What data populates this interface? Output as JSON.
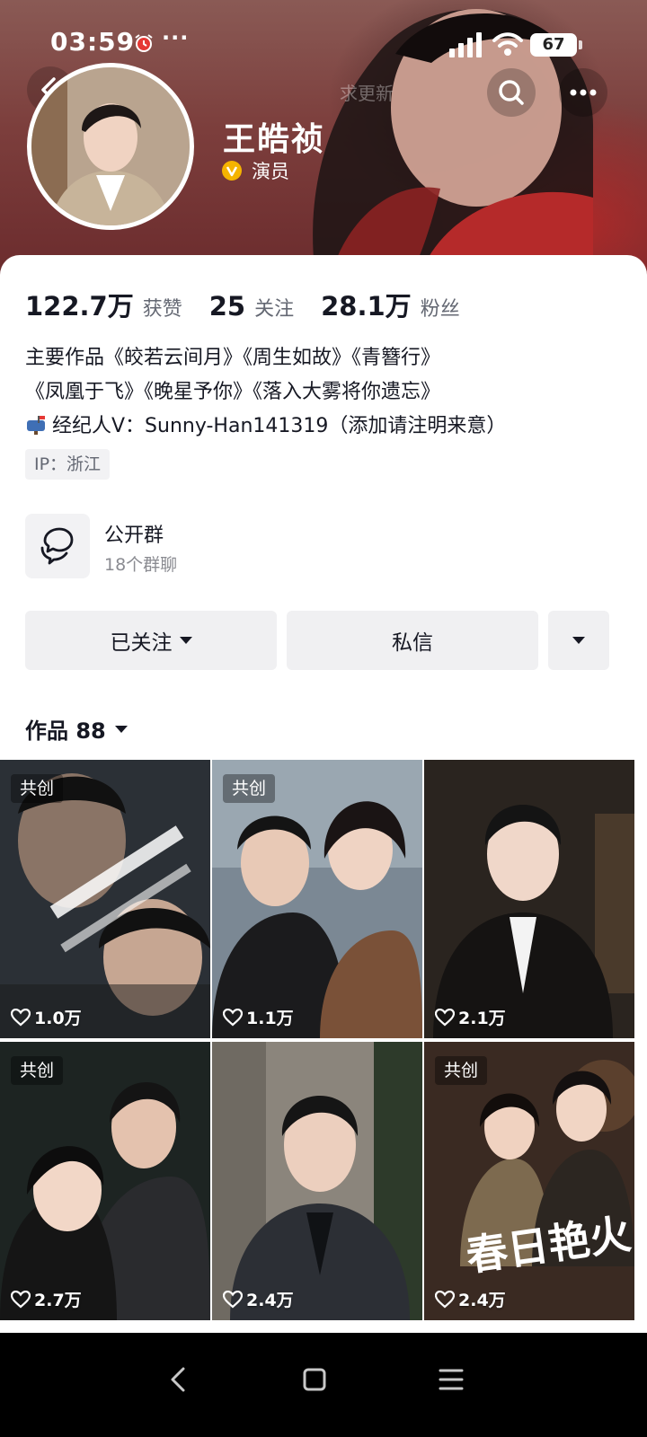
{
  "status_bar": {
    "time": "03:59",
    "dots": "···",
    "battery": "67"
  },
  "header": {
    "refresh_hint": "求更新"
  },
  "profile": {
    "name": "王皓祯",
    "role": "演员",
    "stats": [
      {
        "value": "122.7万",
        "label": "获赞"
      },
      {
        "value": "25",
        "label": "关注"
      },
      {
        "value": "28.1万",
        "label": "粉丝"
      }
    ],
    "bio": [
      "主要作品《皎若云间月》《周生如故》《青簪行》",
      "《凤凰于飞》《晚星予你》《落入大雾将你遗忘》",
      "经纪人V：Sunny-Han141319（添加请注明来意）"
    ],
    "ip": "IP：浙江"
  },
  "group": {
    "title": "公开群",
    "subtitle": "18个群聊"
  },
  "actions": {
    "follow": "已关注",
    "message": "私信"
  },
  "works": {
    "title": "作品 88",
    "tag_label": "共创",
    "items": [
      {
        "likes": "1.0万",
        "co_created": true
      },
      {
        "likes": "1.1万",
        "co_created": true
      },
      {
        "likes": "2.1万",
        "co_created": false
      },
      {
        "likes": "2.7万",
        "co_created": true
      },
      {
        "likes": "2.4万",
        "co_created": false
      },
      {
        "likes": "2.4万",
        "co_created": true
      }
    ],
    "poster_title_6": "春日艳火"
  },
  "colors": {
    "banner": "#7c3e3c",
    "card": "#ffffff",
    "button_bg": "#f0f0f2",
    "badge": "#f5b400"
  }
}
